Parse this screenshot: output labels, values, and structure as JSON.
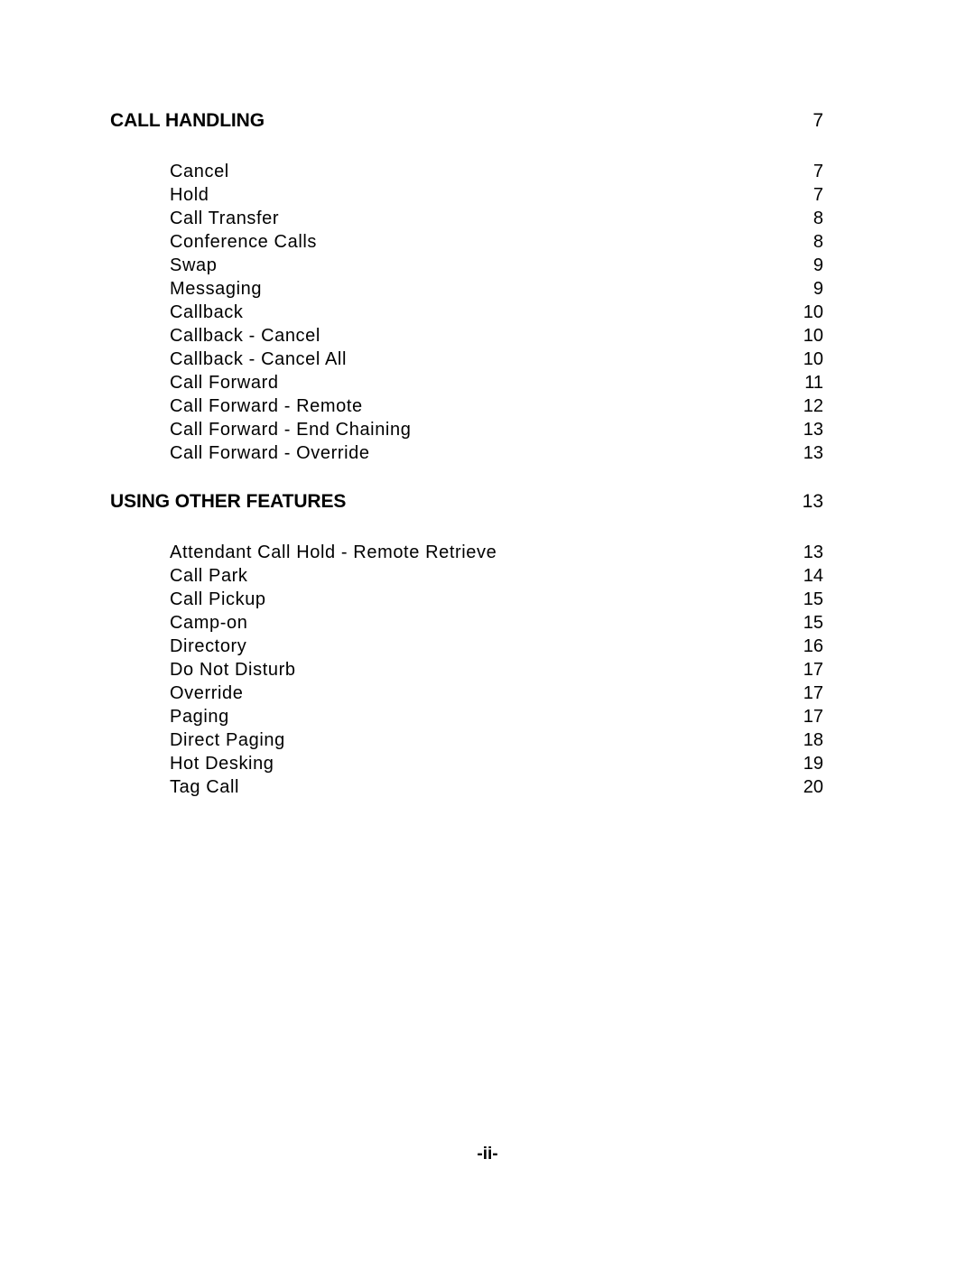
{
  "document": {
    "footer_marker": "-ii-"
  },
  "sections": [
    {
      "heading": "CALL HANDLING",
      "heading_page": "7",
      "entries": [
        {
          "label": "Cancel",
          "page": "7"
        },
        {
          "label": "Hold",
          "page": "7"
        },
        {
          "label": "Call Transfer",
          "page": "8"
        },
        {
          "label": "Conference Calls",
          "page": "8"
        },
        {
          "label": "Swap",
          "page": "9"
        },
        {
          "label": "Messaging",
          "page": "9"
        },
        {
          "label": "Callback",
          "page": "10"
        },
        {
          "label": "Callback - Cancel",
          "page": "10"
        },
        {
          "label": "Callback - Cancel All",
          "page": "10"
        },
        {
          "label": "Call Forward",
          "page": "11"
        },
        {
          "label": "Call Forward - Remote",
          "page": "12"
        },
        {
          "label": "Call Forward - End Chaining",
          "page": "13"
        },
        {
          "label": "Call Forward - Override",
          "page": "13"
        }
      ]
    },
    {
      "heading": "USING OTHER FEATURES",
      "heading_page": "13",
      "entries": [
        {
          "label": "Attendant Call Hold - Remote Retrieve",
          "page": "13"
        },
        {
          "label": "Call Park",
          "page": "14"
        },
        {
          "label": "Call Pickup",
          "page": "15"
        },
        {
          "label": "Camp-on",
          "page": "15"
        },
        {
          "label": "Directory",
          "page": "16"
        },
        {
          "label": "Do Not Disturb",
          "page": "17"
        },
        {
          "label": "Override",
          "page": "17"
        },
        {
          "label": "Paging",
          "page": "17"
        },
        {
          "label": "Direct Paging",
          "page": "18"
        },
        {
          "label": "Hot Desking",
          "page": "19"
        },
        {
          "label": "Tag Call",
          "page": "20"
        }
      ]
    }
  ]
}
